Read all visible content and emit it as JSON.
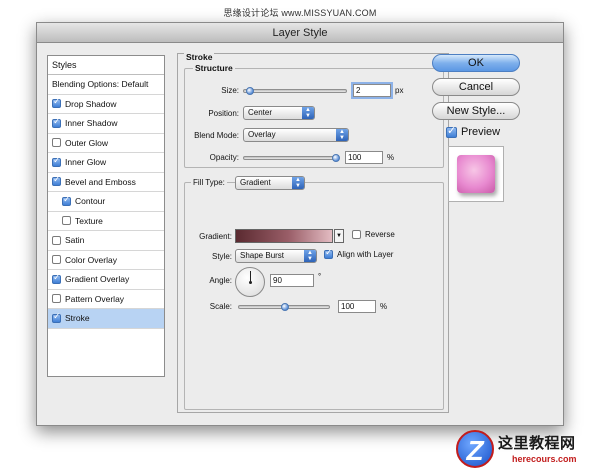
{
  "watermark": "思缘设计论坛 www.MISSYUAN.COM",
  "window": {
    "title": "Layer Style"
  },
  "sidebar": {
    "header": "Styles",
    "items": [
      {
        "label": "Blending Options: Default",
        "checkbox": false,
        "checked": false,
        "selected": false
      },
      {
        "label": "Drop Shadow",
        "checkbox": true,
        "checked": true,
        "selected": false
      },
      {
        "label": "Inner Shadow",
        "checkbox": true,
        "checked": true,
        "selected": false
      },
      {
        "label": "Outer Glow",
        "checkbox": true,
        "checked": false,
        "selected": false
      },
      {
        "label": "Inner Glow",
        "checkbox": true,
        "checked": true,
        "selected": false
      },
      {
        "label": "Bevel and Emboss",
        "checkbox": true,
        "checked": true,
        "selected": false
      },
      {
        "label": "Contour",
        "checkbox": true,
        "checked": true,
        "selected": false,
        "sub": true
      },
      {
        "label": "Texture",
        "checkbox": true,
        "checked": false,
        "selected": false,
        "sub": true
      },
      {
        "label": "Satin",
        "checkbox": true,
        "checked": false,
        "selected": false
      },
      {
        "label": "Color Overlay",
        "checkbox": true,
        "checked": false,
        "selected": false
      },
      {
        "label": "Gradient Overlay",
        "checkbox": true,
        "checked": true,
        "selected": false
      },
      {
        "label": "Pattern Overlay",
        "checkbox": true,
        "checked": false,
        "selected": false
      },
      {
        "label": "Stroke",
        "checkbox": true,
        "checked": true,
        "selected": true
      }
    ]
  },
  "stroke": {
    "section_title": "Stroke",
    "structure_title": "Structure",
    "size_label": "Size:",
    "size_value": "2",
    "size_unit": "px",
    "size_level": 0.02,
    "position_label": "Position:",
    "position_value": "Center",
    "blend_label": "Blend Mode:",
    "blend_value": "Overlay",
    "opacity_label": "Opacity:",
    "opacity_value": "100",
    "opacity_unit": "%",
    "opacity_level": 1.0,
    "fill_type_label": "Fill Type:",
    "fill_type_value": "Gradient",
    "gradient_label": "Gradient:",
    "gradient_colors": [
      "#5a2a30",
      "#9a5e68",
      "#e3bcc2"
    ],
    "reverse_label": "Reverse",
    "reverse_checked": false,
    "style_label": "Style:",
    "style_value": "Shape Burst",
    "align_label": "Align with Layer",
    "align_checked": true,
    "angle_label": "Angle:",
    "angle_value": "90",
    "angle_unit": "°",
    "scale_label": "Scale:",
    "scale_value": "100",
    "scale_unit": "%",
    "scale_level": 0.5
  },
  "buttons": {
    "ok": "OK",
    "cancel": "Cancel",
    "new_style": "New Style...",
    "preview_label": "Preview",
    "preview_checked": true
  },
  "logo": {
    "letter": "Z",
    "cn": "这里教程网",
    "en": "herecours.com"
  },
  "colors": {
    "accent": "#5c97e4",
    "selected_row": "#b8d3f3",
    "preview_pink": "#e88ad0"
  }
}
